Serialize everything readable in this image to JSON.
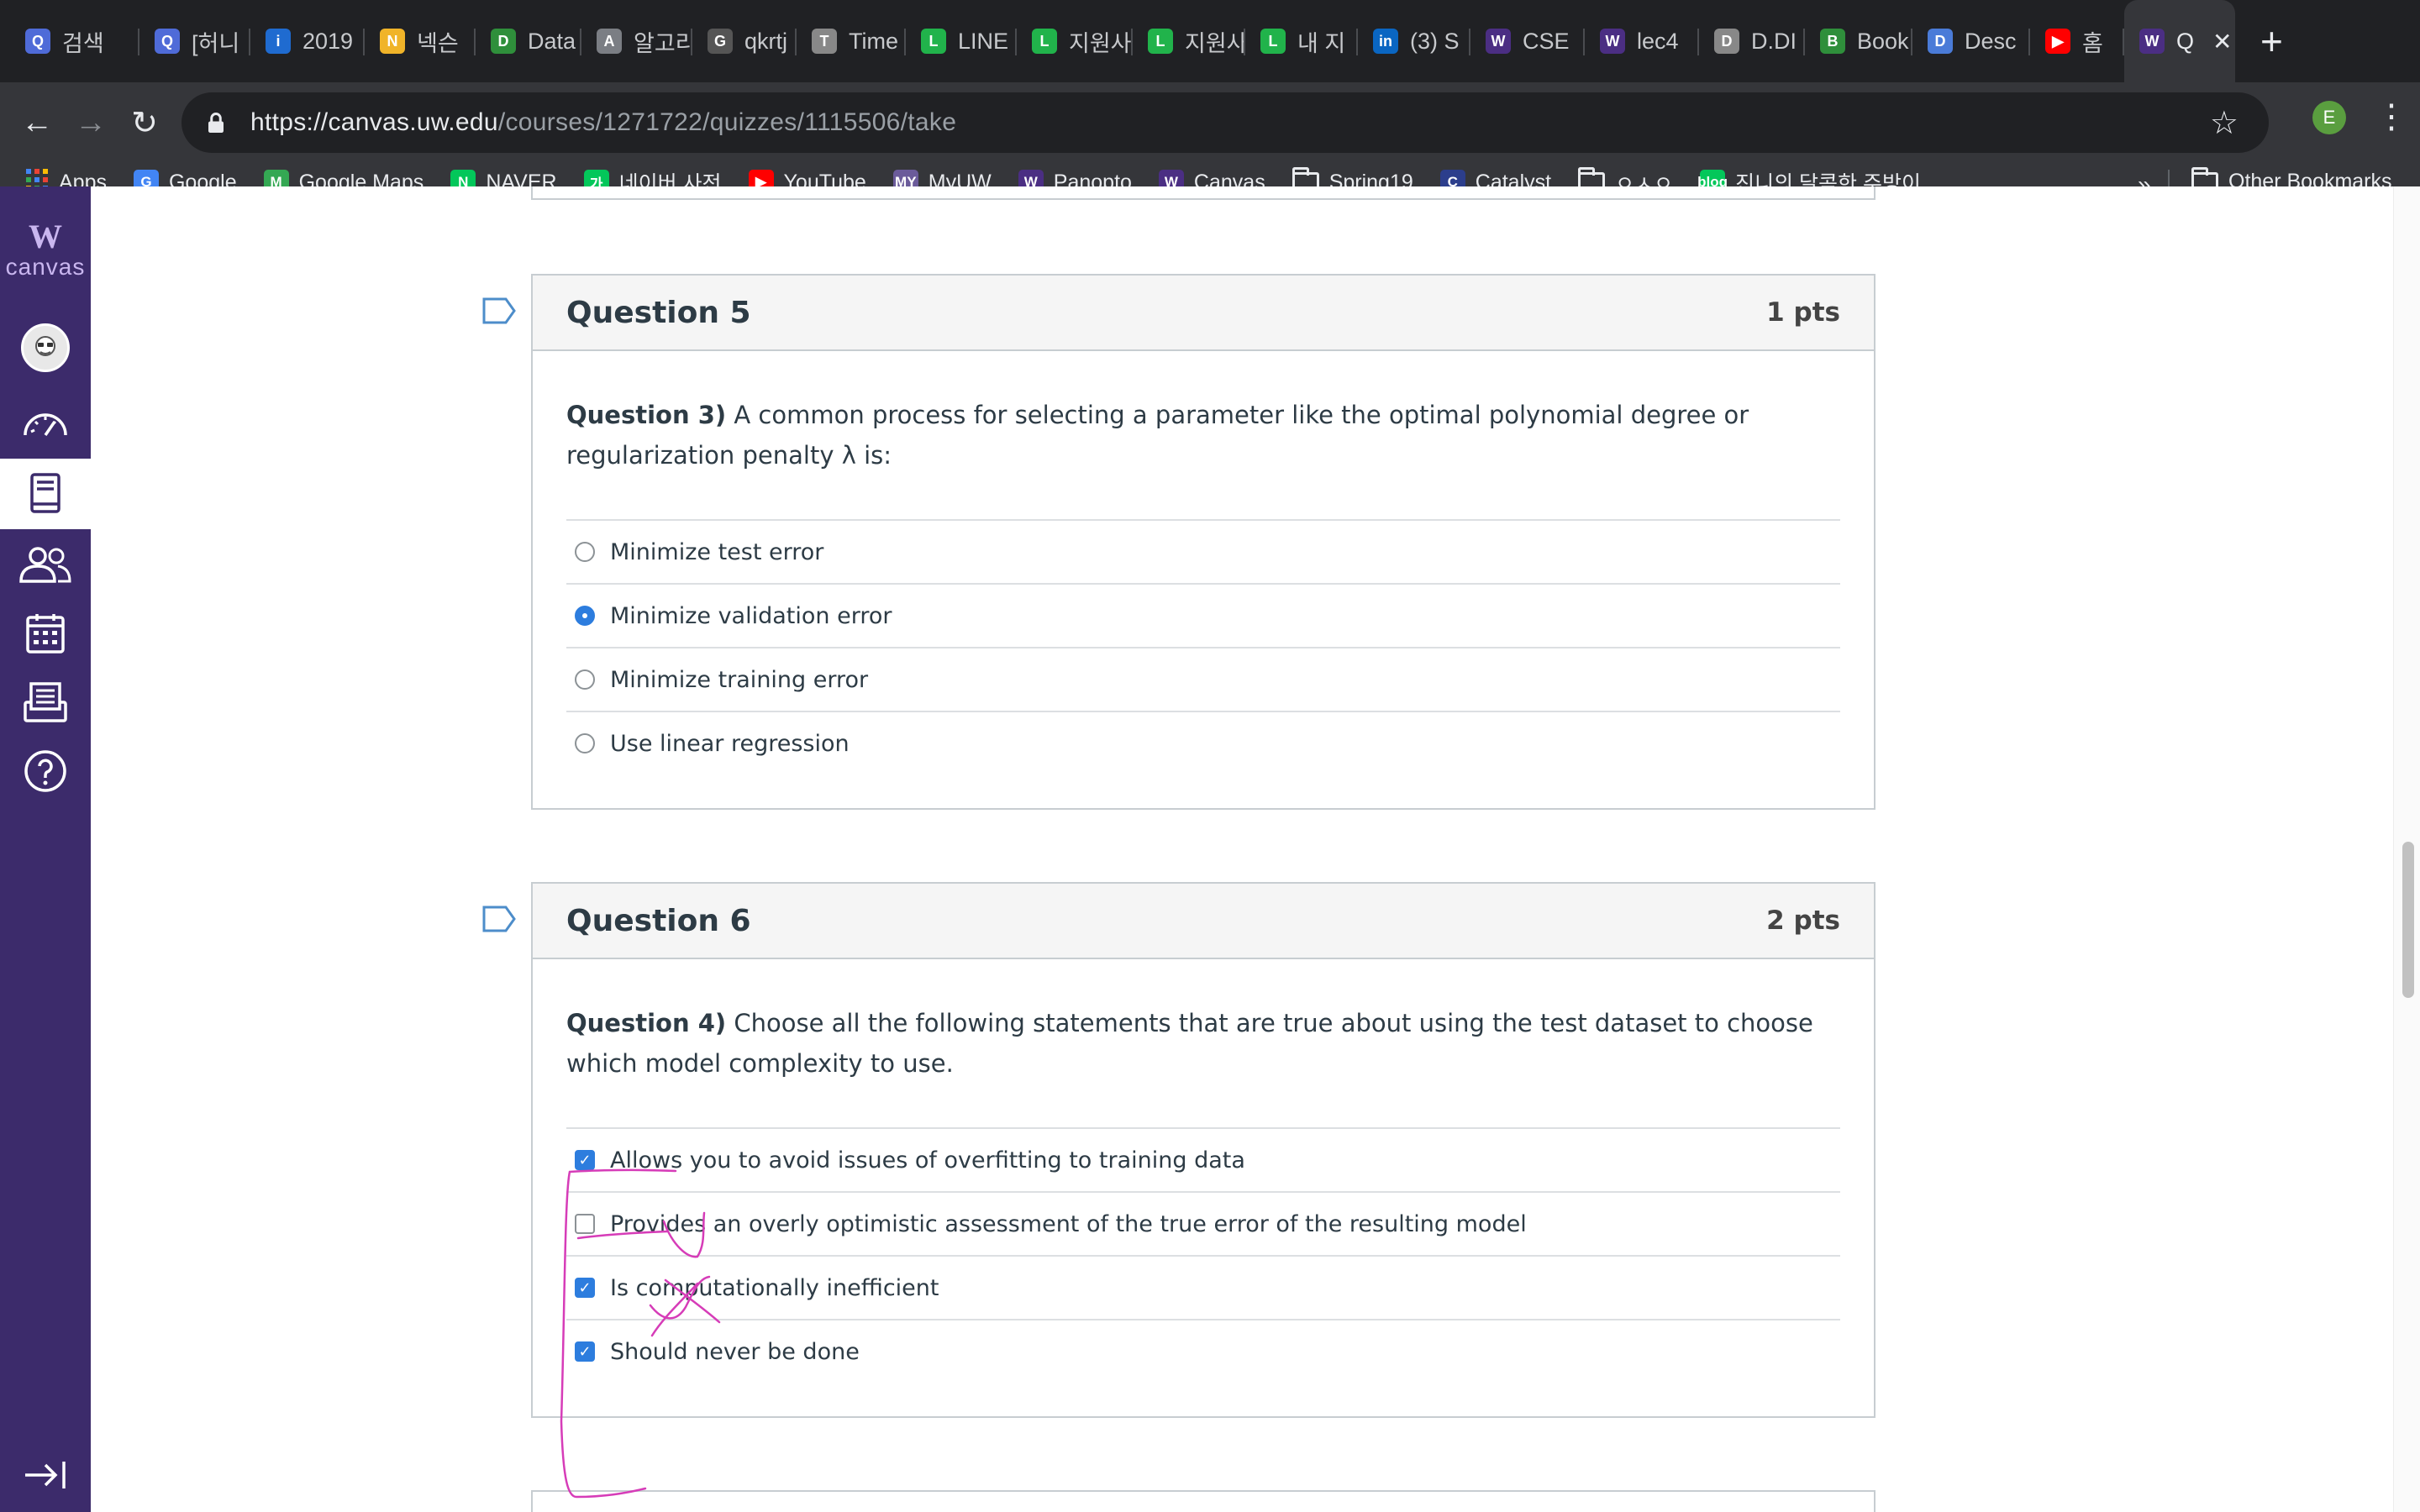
{
  "tabs": [
    {
      "label": "검색",
      "icon": "Q",
      "color": "#4f6bd8"
    },
    {
      "label": "[허니",
      "icon": "Q",
      "color": "#4f6bd8"
    },
    {
      "label": "2019",
      "icon": "i",
      "color": "#1f6bd0"
    },
    {
      "label": "넥슨",
      "icon": "N",
      "color": "#f0b429"
    },
    {
      "label": "Data",
      "icon": "D",
      "color": "#2f8f3b"
    },
    {
      "label": "알고리",
      "icon": "A",
      "color": "#7b7e84"
    },
    {
      "label": "qkrtj",
      "icon": "G",
      "color": "#555"
    },
    {
      "label": "Time",
      "icon": "T",
      "color": "#888"
    },
    {
      "label": "LINE",
      "icon": "L",
      "color": "#21b34b"
    },
    {
      "label": "지원사",
      "icon": "L",
      "color": "#21b34b"
    },
    {
      "label": "지원사",
      "icon": "L",
      "color": "#21b34b"
    },
    {
      "label": "내 지",
      "icon": "L",
      "color": "#21b34b"
    },
    {
      "label": "(3) S",
      "icon": "in",
      "color": "#0a66c2"
    },
    {
      "label": "CSE",
      "icon": "W",
      "color": "#4b2e83"
    },
    {
      "label": "lec4",
      "icon": "W",
      "color": "#4b2e83"
    },
    {
      "label": "D.DI",
      "icon": "D",
      "color": "#888"
    },
    {
      "label": "Book",
      "icon": "B",
      "color": "#2f8f3b"
    },
    {
      "label": "Desc",
      "icon": "D",
      "color": "#4a7bd8"
    },
    {
      "label": "홈",
      "icon": "▶",
      "color": "#ff0000"
    },
    {
      "label": "Q",
      "icon": "W",
      "color": "#4b2e83",
      "active": true
    }
  ],
  "address": {
    "host": "https://canvas.uw.edu",
    "path": "/courses/1271722/quizzes/1115506/take",
    "profile_initial": "E"
  },
  "bookmarks": [
    {
      "label": "Apps",
      "icon": "apps",
      "color": "#e8eaed"
    },
    {
      "label": "Google",
      "icon": "G",
      "color": "#4285f4"
    },
    {
      "label": "Google Maps",
      "icon": "M",
      "color": "#34a853"
    },
    {
      "label": "NAVER",
      "icon": "N",
      "color": "#03c75a"
    },
    {
      "label": "네이버 사전",
      "icon": "가",
      "color": "#03c75a"
    },
    {
      "label": "YouTube",
      "icon": "▶",
      "color": "#ff0000"
    },
    {
      "label": "MyUW",
      "icon": "MY",
      "color": "#6b5b9a"
    },
    {
      "label": "Panopto",
      "icon": "W",
      "color": "#4b2e83"
    },
    {
      "label": "Canvas",
      "icon": "W",
      "color": "#4b2e83"
    },
    {
      "label": "Spring19",
      "icon": "folder",
      "color": "#e8eaed"
    },
    {
      "label": "Catalyst",
      "icon": "C",
      "color": "#2c3e8c"
    },
    {
      "label": "ㅇㅅㅇ",
      "icon": "folder",
      "color": "#e8eaed"
    },
    {
      "label": "진니의 달콤한 주방이...",
      "icon": "blog",
      "color": "#03c75a"
    }
  ],
  "bookmarks_overflow": "»",
  "other_bookmarks": "Other Bookmarks",
  "canvas": {
    "logo_mark": "W",
    "logo_text": "canvas"
  },
  "questions": [
    {
      "title": "Question 5",
      "points": "1 pts",
      "prefix": "Question 3)",
      "text": " A common process for selecting a parameter like the optimal polynomial degree or regularization penalty λ  is:",
      "type": "radio",
      "answers": [
        {
          "label": "Minimize test error",
          "selected": false
        },
        {
          "label": "Minimize validation error",
          "selected": true
        },
        {
          "label": "Minimize training error",
          "selected": false
        },
        {
          "label": "Use linear regression",
          "selected": false
        }
      ]
    },
    {
      "title": "Question 6",
      "points": "2 pts",
      "prefix": "Question 4)",
      "text": " Choose all the following statements that are true about using the test dataset to choose which model complexity to use.",
      "type": "checkbox",
      "answers": [
        {
          "label": "Allows you to avoid issues of overfitting to training data",
          "selected": true
        },
        {
          "label": "Provides an overly optimistic assessment of the true error of the resulting model",
          "selected": false
        },
        {
          "label": "Is computationally inefficient",
          "selected": true
        },
        {
          "label": "Should never be done",
          "selected": true
        }
      ]
    }
  ],
  "colors": {
    "canvas_nav": "#3c2b6b",
    "annotation": "#d63cb8",
    "selected": "#2d7dde"
  }
}
